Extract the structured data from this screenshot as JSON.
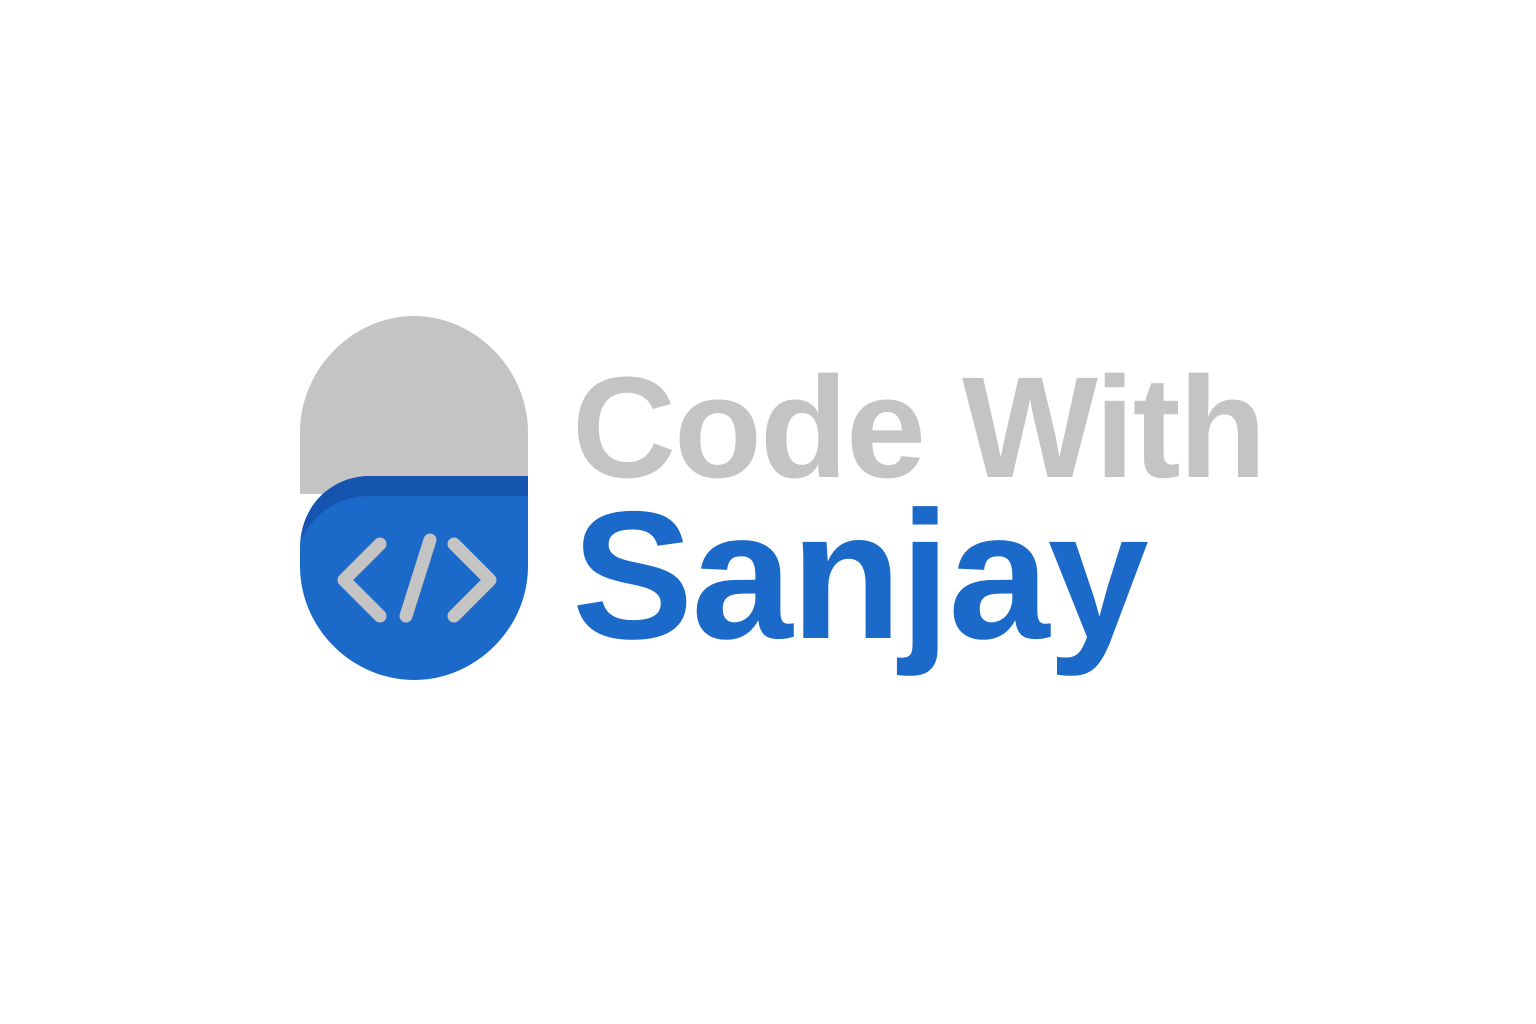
{
  "brand": {
    "line1": "Code With",
    "line2": "Sanjay",
    "icon": "code-brackets-icon",
    "colors": {
      "gray": "#c4c4c4",
      "blue": "#1b69c8",
      "blue_dark": "#1555b0",
      "background": "#ffffff"
    }
  }
}
